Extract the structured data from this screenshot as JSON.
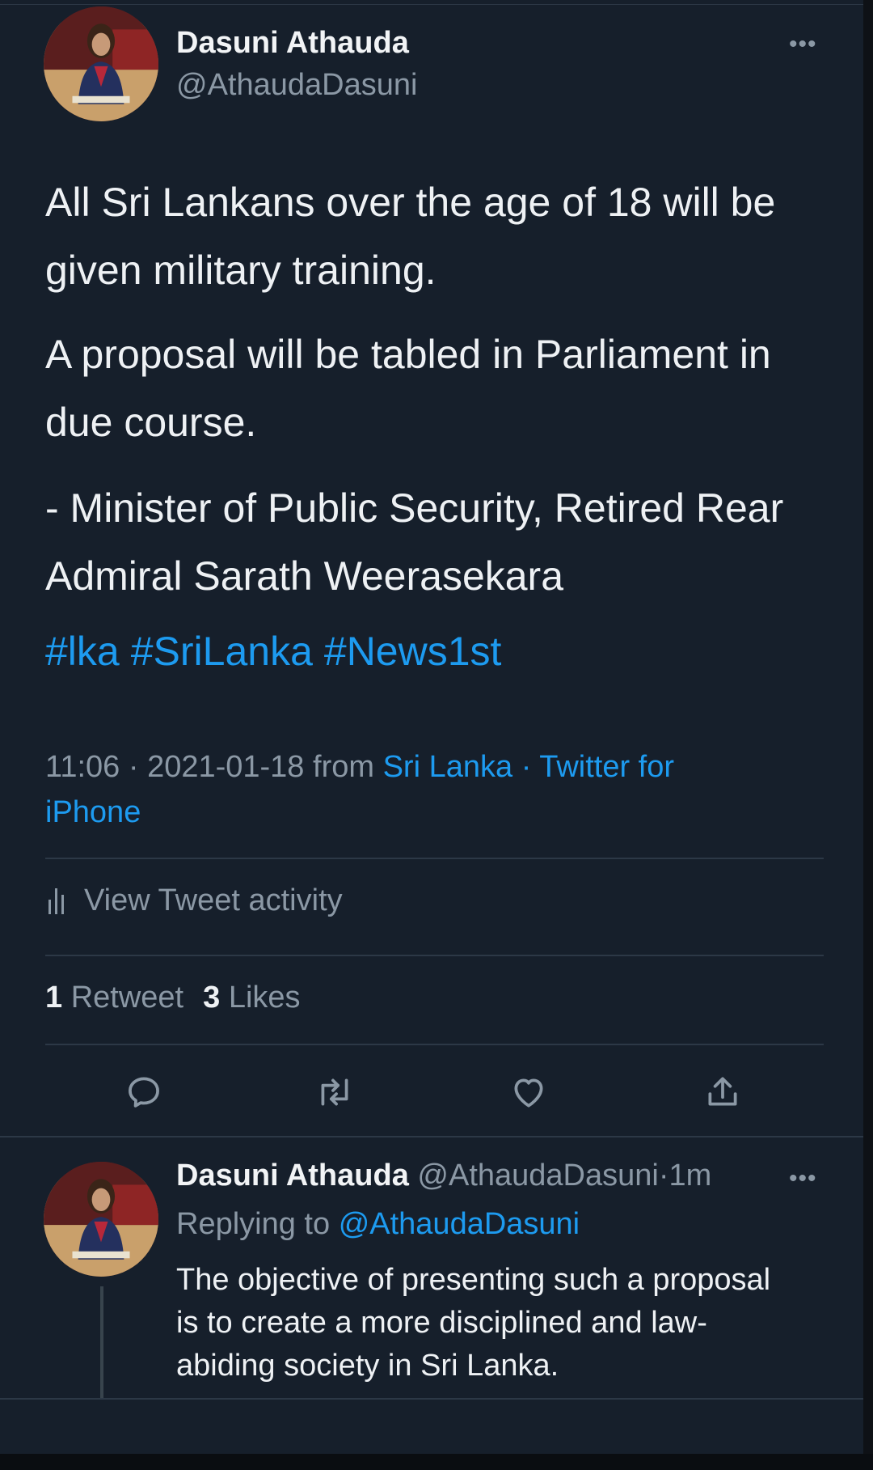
{
  "main_tweet": {
    "author_name": "Dasuni Athauda",
    "author_handle": "@AthaudaDasuni",
    "more_label": "•••",
    "paragraphs": [
      "All Sri Lankans over the age of 18 will be given military training.",
      "A proposal will be tabled in Parliament in due course.",
      "- Minister of Public Security, Retired Rear Admiral Sarath Weerasekara"
    ],
    "hashtags": [
      "#lka",
      "#SriLanka",
      "#News1st"
    ],
    "time": "11:06",
    "date": "2021-01-18",
    "from_word": "from",
    "location": "Sri Lanka",
    "separator": "·",
    "client": "Twitter for iPhone",
    "view_activity_label": "View Tweet activity",
    "retweet_count": "1",
    "retweet_label": "Retweet",
    "like_count": "3",
    "like_label": "Likes",
    "actions": [
      {
        "name": "reply-icon"
      },
      {
        "name": "retweet-icon"
      },
      {
        "name": "like-icon"
      },
      {
        "name": "share-icon"
      }
    ]
  },
  "reply_tweet": {
    "author_name": "Dasuni Athauda",
    "author_handle": "@AthaudaDasuni",
    "separator": "·",
    "age": "1m",
    "more_label": "•••",
    "replying_to_label": "Replying to",
    "replying_to_handle": "@AthaudaDasuni",
    "text": "The objective of presenting such a proposal is to create a more disciplined and law-abiding society in Sri Lanka."
  },
  "colors": {
    "background": "#161f2b",
    "accent": "#1d9bf0",
    "muted": "#8b98a5",
    "text": "#eef1f4"
  }
}
